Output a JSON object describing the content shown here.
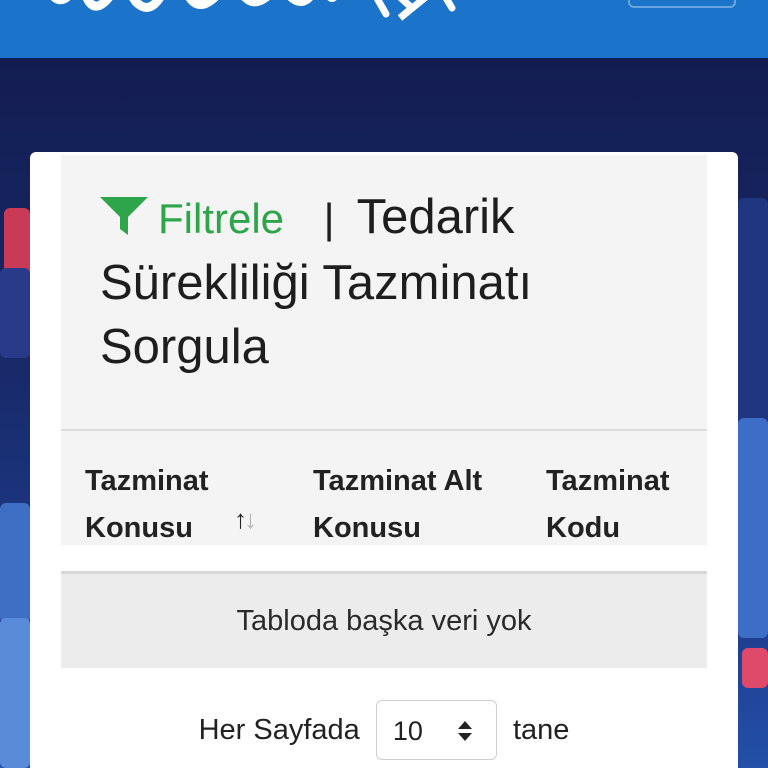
{
  "header": {
    "logo_name": "brand-logo",
    "menu_icon": "menu-toggle-icon"
  },
  "card": {
    "filter_icon": "funnel-icon",
    "filter_label": "Filtrele",
    "title_separator": "|",
    "title": "Tedarik Sürekliliği Tazminatı Sorgula",
    "filter_color": "#2ea54b"
  },
  "table": {
    "columns": [
      {
        "label": "Tazminat Konusu",
        "sortable": true,
        "sort_icon": "sort-arrows-icon"
      },
      {
        "label": "Tazminat Alt Konusu"
      },
      {
        "label": "Tazminat Kodu"
      }
    ],
    "empty_message": "Tabloda başka veri yok"
  },
  "pagination": {
    "prefix": "Her Sayfada",
    "page_size": "10",
    "suffix": "tane"
  },
  "colors": {
    "topbar": "#1b74c9",
    "background": "#15225a"
  }
}
